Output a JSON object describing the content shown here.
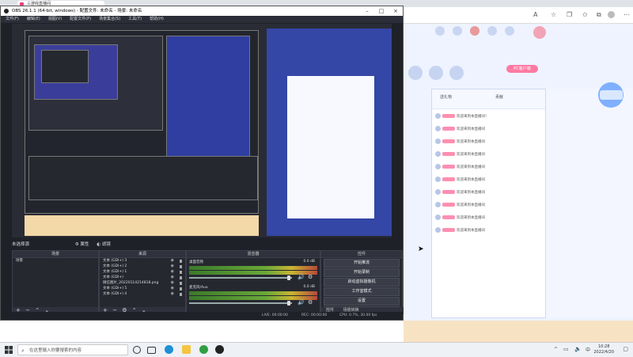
{
  "browser": {
    "tab_title": "三游戏直播间",
    "page": {
      "nav_items": [
        "",
        "",
        "",
        "",
        "",
        "",
        "",
        "",
        ""
      ],
      "nav_labels": [
        "",
        "",
        "",
        "",
        "",
        ""
      ],
      "pc_client_btn": "PC客户端",
      "chat_header_left": "送礼物",
      "chat_header_right": "贡献",
      "chat_rows": [
        "欢迎来到本直播间！",
        "欢迎来到本直播间",
        "欢迎来到本直播间",
        "欢迎来到本直播间",
        "欢迎来到本直播间",
        "欢迎来到本直播间",
        "欢迎来到本直播间",
        "欢迎来到本直播间",
        "欢迎来到本直播间",
        "欢迎来到本直播间"
      ]
    }
  },
  "obs": {
    "title": "OBS 26.1.1 (64-bit, windows) - 配置文件: 未命名 - 场景: 未命名",
    "menu": [
      "文件(F)",
      "编辑(E)",
      "视图(V)",
      "配置文件(P)",
      "场景集合(S)",
      "工具(T)",
      "帮助(H)"
    ],
    "scene_label": "未选择源",
    "props_label": "属性",
    "filters_label": "滤镜",
    "docks": {
      "scenes": {
        "title": "场景",
        "items": [
          "场景"
        ]
      },
      "sources": {
        "title": "来源",
        "items": [
          "文本 (GDI+) 3",
          "文本 (GDI+) 2",
          "文本 (GDI+) 1",
          "文本 (GDI+)",
          "微信图片_20220114214818.png",
          "文本 (GDI+) 5",
          "文本 (GDI+) 4"
        ]
      },
      "mixer": {
        "title": "混音器",
        "channels": [
          {
            "name": "桌面音频",
            "db": "0.0 dB"
          },
          {
            "name": "麦克风/Aux",
            "db": "0.0 dB"
          }
        ]
      },
      "controls": {
        "title": "控件",
        "buttons": [
          "开始推流",
          "开始录制",
          "启动虚拟摄像机",
          "工作室模式",
          "设置",
          "退出"
        ],
        "tabs": [
          "控件",
          "场景转换"
        ]
      }
    },
    "status": {
      "live": "LIVE: 00:00:00",
      "rec": "REC: 00:00:00",
      "cpu": "CPU: 0.7%, 30.00 fps"
    }
  },
  "taskbar": {
    "search_placeholder": "在这里输入你要搜索的内容",
    "time": "10:28",
    "date": "2022/4/20"
  }
}
